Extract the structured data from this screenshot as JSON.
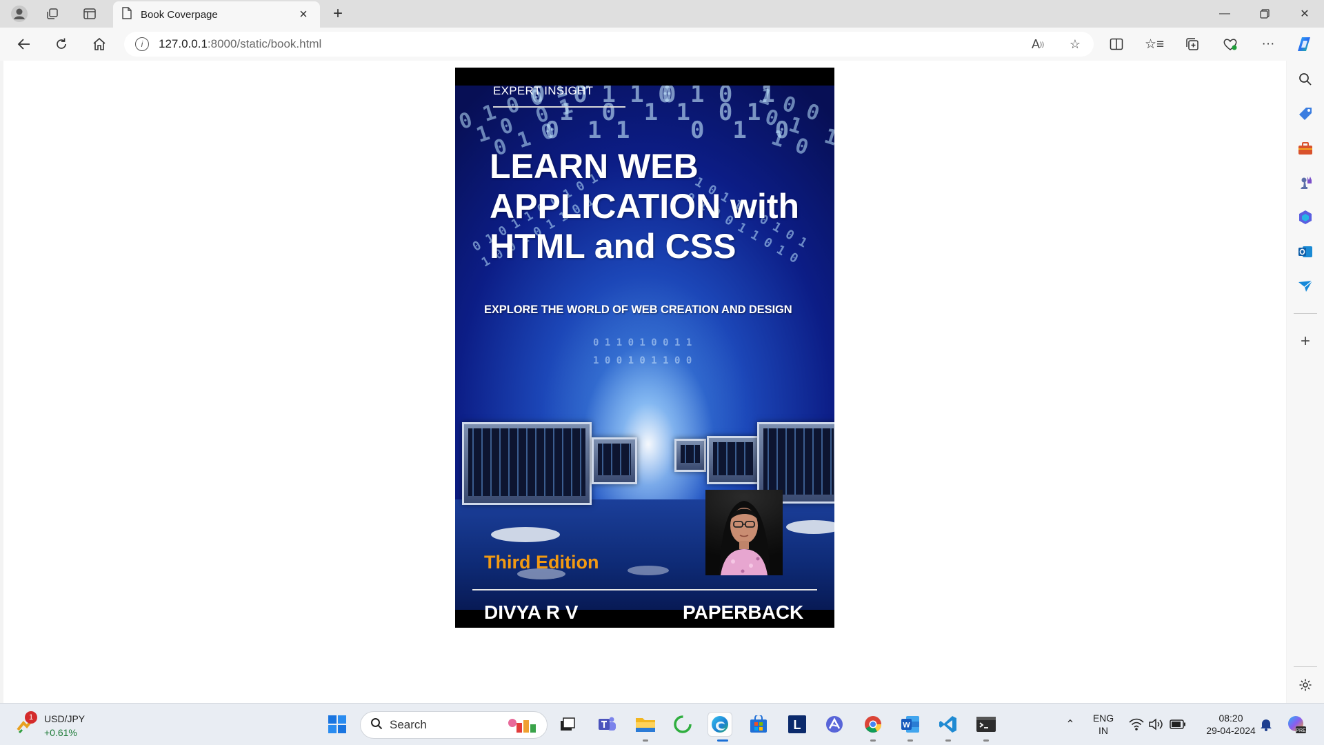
{
  "browser": {
    "tab_title": "Book Coverpage",
    "address_host": "127.0.0.1",
    "address_rest": ":8000/static/book.html"
  },
  "cover": {
    "series_label": "EXPERT INSIGHT",
    "title_line1": "LEARN WEB",
    "title_line2": "APPLICATION with",
    "title_line3": "HTML and CSS",
    "subtitle": "EXPLORE THE WORLD OF WEB CREATION AND DESIGN",
    "edition": "Third Edition",
    "author": "DIVYA R V",
    "format": "PAPERBACK",
    "edition_color": "#f29a12"
  },
  "taskbar": {
    "ticker_symbol": "USD/JPY",
    "ticker_change": "+0.61%",
    "ticker_badge": "1",
    "search_placeholder": "Search",
    "language_line1": "ENG",
    "language_line2": "IN",
    "time": "08:20",
    "date": "29-04-2024"
  }
}
